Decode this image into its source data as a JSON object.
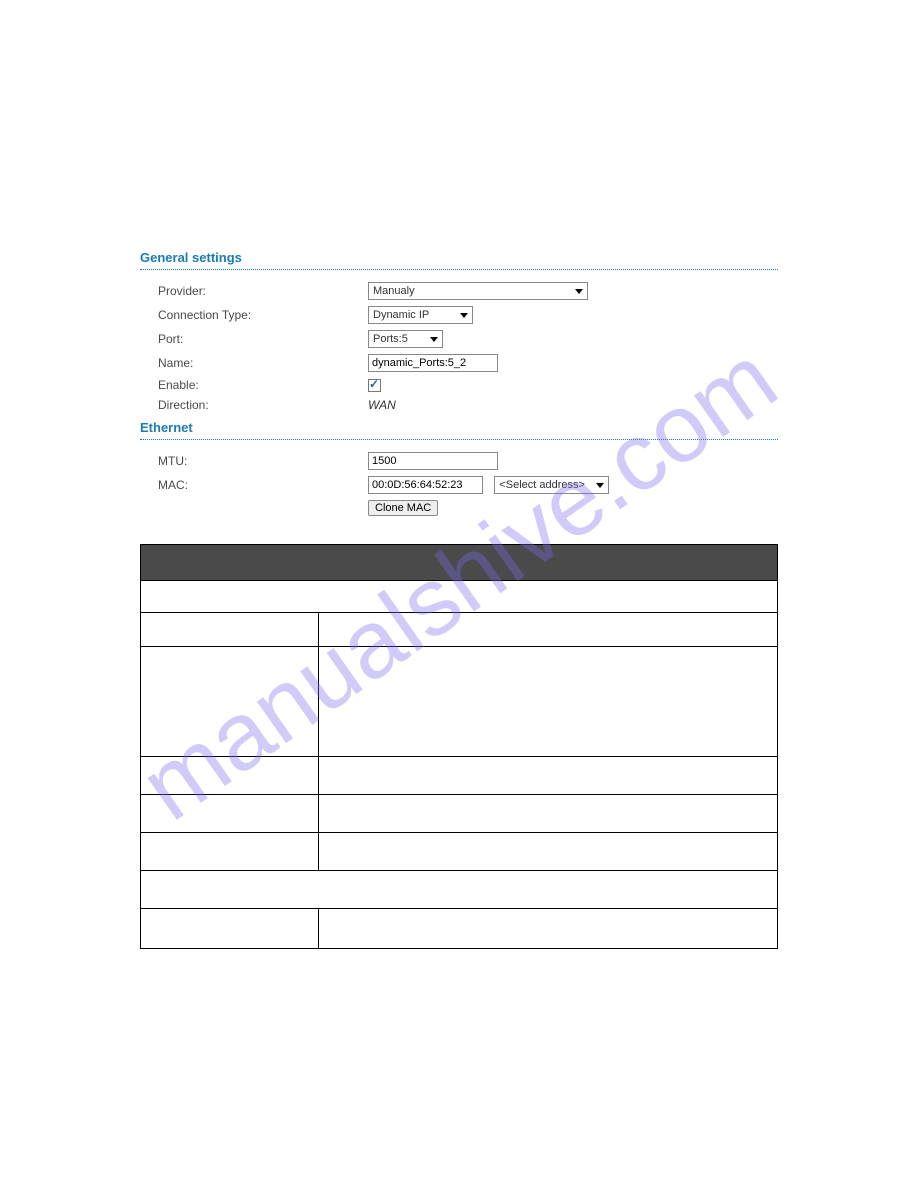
{
  "watermark": "manualshive.com",
  "sections": {
    "general": {
      "title": "General settings",
      "provider": {
        "label": "Provider:",
        "value": "Manualy"
      },
      "connection_type": {
        "label": "Connection Type:",
        "value": "Dynamic IP"
      },
      "port": {
        "label": "Port:",
        "value": "Ports:5"
      },
      "name": {
        "label": "Name:",
        "value": "dynamic_Ports:5_2"
      },
      "enable": {
        "label": "Enable:",
        "checked": true
      },
      "direction": {
        "label": "Direction:",
        "value": "WAN"
      }
    },
    "ethernet": {
      "title": "Ethernet",
      "mtu": {
        "label": "MTU:",
        "value": "1500"
      },
      "mac": {
        "label": "MAC:",
        "value": "00:0D:56:64:52:23",
        "select_placeholder": "<Select address>",
        "clone_label": "Clone MAC"
      }
    }
  },
  "table": {
    "header": "",
    "rows": [
      {
        "type": "caption",
        "span": 2
      },
      {
        "type": "header"
      },
      {
        "type": "tall"
      },
      {
        "type": "med"
      },
      {
        "type": "med"
      },
      {
        "type": "med"
      },
      {
        "type": "section",
        "span": 2
      },
      {
        "type": "last"
      }
    ]
  }
}
